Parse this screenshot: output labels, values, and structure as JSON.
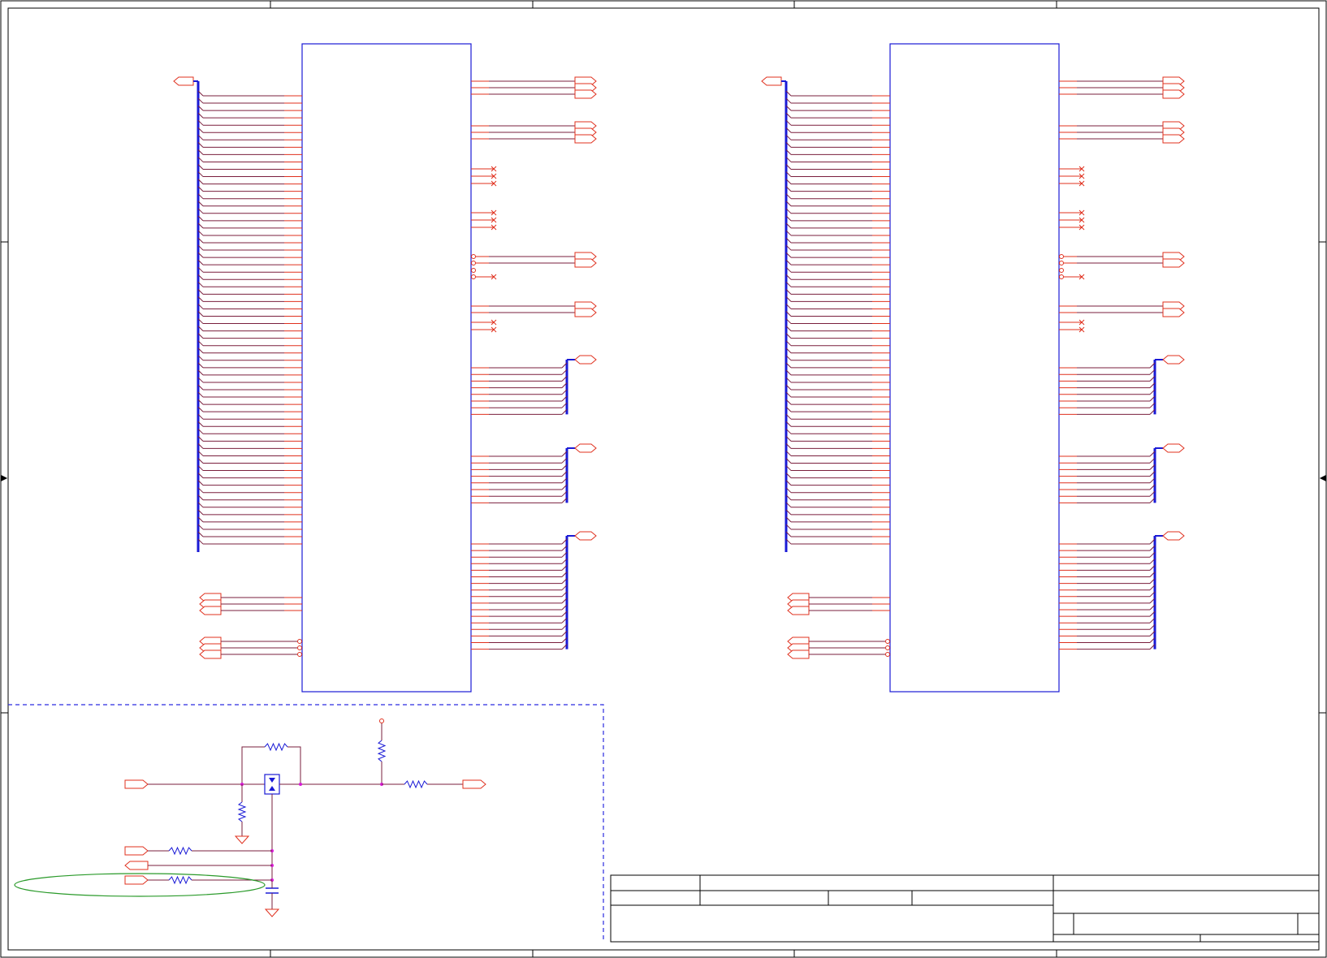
{
  "sheet": {
    "frame_color": "#000000",
    "wire_color": "#e0301e",
    "pin_color": "#7a1f3d",
    "bus_color": "#1a1ad6",
    "part_color": "#1a1ad6",
    "junction_color": "#d61ad6",
    "annotation_color": "#2a9a2a",
    "region_color": "#2a2ae0"
  },
  "icons": [
    "port-flag-icon",
    "no-connect-icon",
    "resistor-icon",
    "capacitor-icon",
    "ground-icon",
    "transistor-icon",
    "power-pin-icon"
  ]
}
